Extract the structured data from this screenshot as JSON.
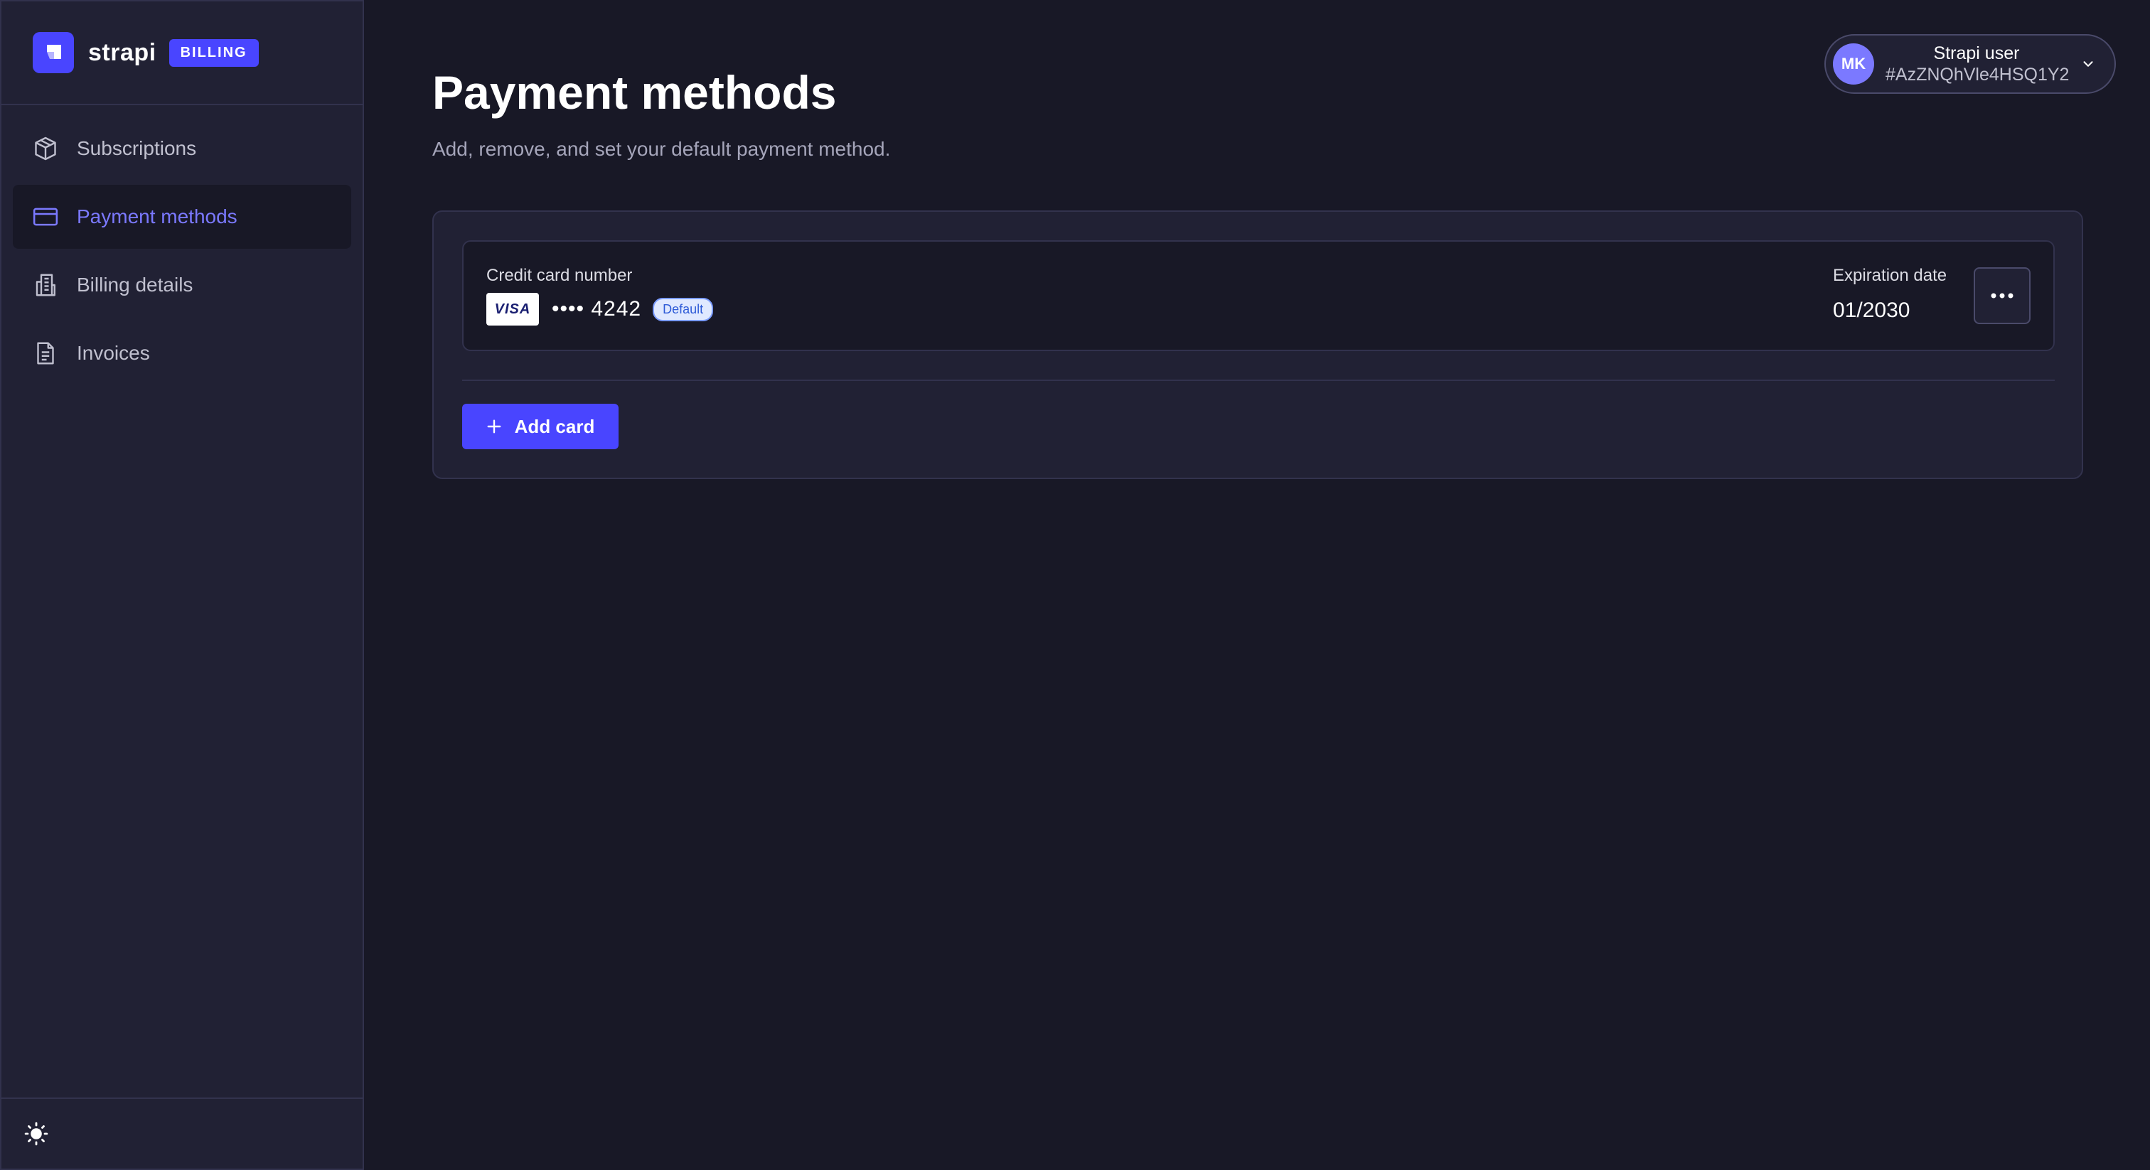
{
  "brand": {
    "name": "strapi",
    "badge": "BILLING",
    "accent_color": "#4945ff"
  },
  "sidebar": {
    "items": [
      {
        "label": "Subscriptions",
        "icon": "package-icon",
        "active": false
      },
      {
        "label": "Payment methods",
        "icon": "credit-card-icon",
        "active": true
      },
      {
        "label": "Billing details",
        "icon": "building-icon",
        "active": false
      },
      {
        "label": "Invoices",
        "icon": "document-icon",
        "active": false
      }
    ],
    "footer_icon": "sun-icon"
  },
  "header": {
    "title": "Payment methods",
    "subtitle": "Add, remove, and set your default payment method."
  },
  "user": {
    "initials": "MK",
    "name": "Strapi user",
    "id": "#AzZNQhVle4HSQ1Y2"
  },
  "payment_method": {
    "number_label": "Credit card number",
    "brand": "VISA",
    "masked_number": "•••• 4242",
    "default_badge": "Default",
    "expiration_label": "Expiration date",
    "expiration_value": "01/2030",
    "more_icon": "ellipsis-icon"
  },
  "actions": {
    "add_card_label": "Add card"
  }
}
